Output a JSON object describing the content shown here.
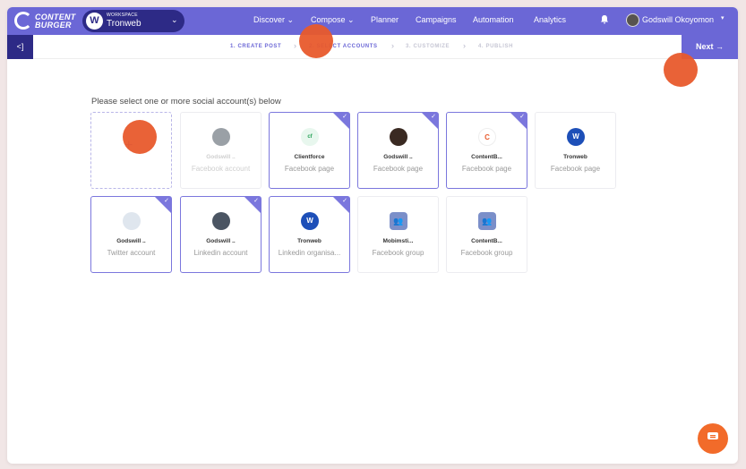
{
  "logo": {
    "line1": "CONTENT",
    "line2": "BURGER"
  },
  "workspace": {
    "label": "WORKSPACE",
    "name": "Tronweb",
    "avatar_letter": "W"
  },
  "nav": [
    {
      "label": "Discover ⌄"
    },
    {
      "label": "Compose ⌄"
    },
    {
      "label": "Planner"
    },
    {
      "label": "Campaigns"
    },
    {
      "label": "Automation"
    },
    {
      "label": "Analytics"
    }
  ],
  "user": {
    "name": "Godswill Okoyomon",
    "caret": "▾"
  },
  "icons": {
    "bell": "bell-icon",
    "back": "back-icon",
    "next": "arrow-right-icon",
    "chat": "chat-icon"
  },
  "stepper": {
    "back_label": "<]",
    "steps": [
      {
        "label": "1. CREATE POST",
        "state": "active"
      },
      {
        "label": "2. SELECT ACCOUNTS",
        "state": "active"
      },
      {
        "label": "3. CUSTOMIZE",
        "state": "inactive"
      },
      {
        "label": "4. PUBLISH",
        "state": "inactive"
      }
    ],
    "next_label": "Next →"
  },
  "prompt": "Please select one or more social account(s) below",
  "accounts": [
    {
      "name": "Godswill ..",
      "kind": "Facebook account",
      "selected": false,
      "disabled": true,
      "avatar_color": "#9aa0a6",
      "avatar_text": ""
    },
    {
      "name": "Clientforce",
      "kind": "Facebook page",
      "selected": true,
      "disabled": false,
      "avatar_color": "#e8f7ee",
      "avatar_text": "cf"
    },
    {
      "name": "Godswill ..",
      "kind": "Facebook page",
      "selected": true,
      "disabled": false,
      "avatar_color": "#3a2a22",
      "avatar_text": ""
    },
    {
      "name": "ContentB...",
      "kind": "Facebook page",
      "selected": true,
      "disabled": false,
      "avatar_color": "#ffffff",
      "avatar_text": "C"
    },
    {
      "name": "Tronweb",
      "kind": "Facebook page",
      "selected": false,
      "disabled": false,
      "avatar_color": "#1d4fb8",
      "avatar_text": "W"
    },
    {
      "name": "Godswill ..",
      "kind": "Twitter account",
      "selected": true,
      "disabled": false,
      "avatar_color": "#dfe6ee",
      "avatar_text": ""
    },
    {
      "name": "Godswill ..",
      "kind": "Linkedin account",
      "selected": true,
      "disabled": false,
      "avatar_color": "#4b5563",
      "avatar_text": ""
    },
    {
      "name": "Tronweb",
      "kind": "Linkedin organisa...",
      "selected": true,
      "disabled": false,
      "avatar_color": "#1d4fb8",
      "avatar_text": "W"
    },
    {
      "name": "Mobimsti...",
      "kind": "Facebook group",
      "selected": false,
      "disabled": false,
      "avatar_color": "#7b8fc9",
      "avatar_text": "👥"
    },
    {
      "name": "ContentB...",
      "kind": "Facebook group",
      "selected": false,
      "disabled": false,
      "avatar_color": "#7b8fc9",
      "avatar_text": "👥"
    }
  ],
  "add_card_icon": "plus-icon",
  "accent": "#6b67d6"
}
